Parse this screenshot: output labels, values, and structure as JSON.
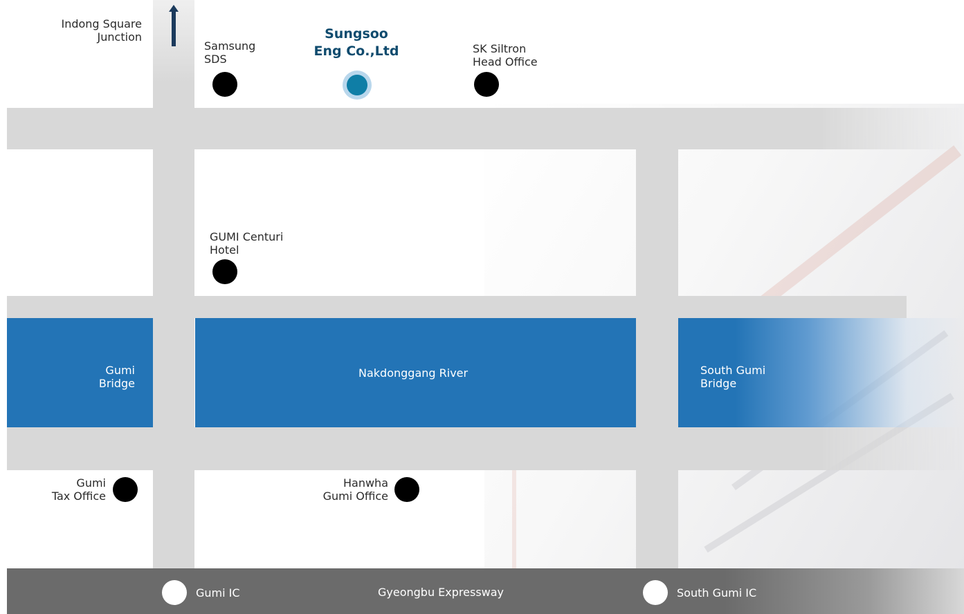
{
  "map": {
    "company": "Sungsoo\nEng Co.,Ltd",
    "colors": {
      "road": "#d8d8d8",
      "river": "#2374b6",
      "expressway": "#6b6b6b",
      "company_dot": "#0f7ea6",
      "company_text": "#0f4b6e",
      "landmark_dot": "#000000",
      "ic_dot": "#ffffff"
    },
    "icons": {
      "direction_arrow": "up-arrow-icon",
      "landmark": "black-dot-icon",
      "company": "blue-dot-icon",
      "interchange": "white-dot-icon"
    },
    "landmarks": {
      "indong": "Indong Square\nJunction",
      "samsung": "Samsung\nSDS",
      "sk": "SK Siltron\nHead Office",
      "hotel": "GUMI Centuri\nHotel",
      "tax": "Gumi\nTax Office",
      "hanwha": "Hanwha\nGumi Office"
    },
    "water": {
      "gumi_bridge": "Gumi\nBridge",
      "river": "Nakdonggang River",
      "south_bridge": "South Gumi\nBridge"
    },
    "expressway": {
      "name": "Gyeongbu Expressway",
      "ic_left": "Gumi IC",
      "ic_right": "South Gumi IC"
    }
  }
}
